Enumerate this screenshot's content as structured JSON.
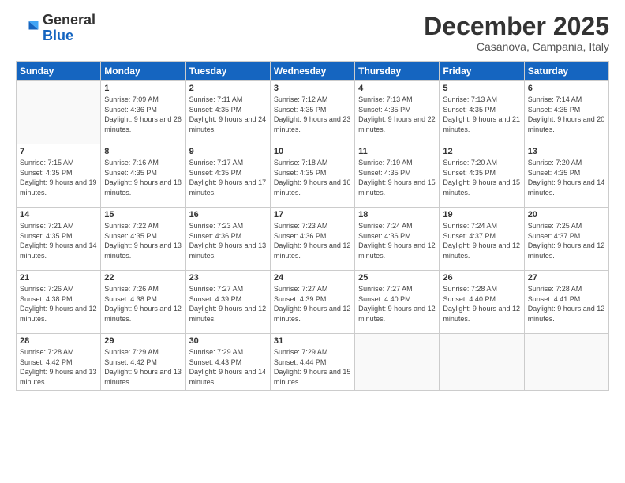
{
  "logo": {
    "general": "General",
    "blue": "Blue"
  },
  "header": {
    "month": "December 2025",
    "location": "Casanova, Campania, Italy"
  },
  "days": [
    "Sunday",
    "Monday",
    "Tuesday",
    "Wednesday",
    "Thursday",
    "Friday",
    "Saturday"
  ],
  "weeks": [
    [
      {
        "num": "",
        "empty": true
      },
      {
        "num": "1",
        "sunrise": "7:09 AM",
        "sunset": "4:36 PM",
        "daylight": "9 hours and 26 minutes."
      },
      {
        "num": "2",
        "sunrise": "7:11 AM",
        "sunset": "4:35 PM",
        "daylight": "9 hours and 24 minutes."
      },
      {
        "num": "3",
        "sunrise": "7:12 AM",
        "sunset": "4:35 PM",
        "daylight": "9 hours and 23 minutes."
      },
      {
        "num": "4",
        "sunrise": "7:13 AM",
        "sunset": "4:35 PM",
        "daylight": "9 hours and 22 minutes."
      },
      {
        "num": "5",
        "sunrise": "7:13 AM",
        "sunset": "4:35 PM",
        "daylight": "9 hours and 21 minutes."
      },
      {
        "num": "6",
        "sunrise": "7:14 AM",
        "sunset": "4:35 PM",
        "daylight": "9 hours and 20 minutes."
      }
    ],
    [
      {
        "num": "7",
        "sunrise": "7:15 AM",
        "sunset": "4:35 PM",
        "daylight": "9 hours and 19 minutes."
      },
      {
        "num": "8",
        "sunrise": "7:16 AM",
        "sunset": "4:35 PM",
        "daylight": "9 hours and 18 minutes."
      },
      {
        "num": "9",
        "sunrise": "7:17 AM",
        "sunset": "4:35 PM",
        "daylight": "9 hours and 17 minutes."
      },
      {
        "num": "10",
        "sunrise": "7:18 AM",
        "sunset": "4:35 PM",
        "daylight": "9 hours and 16 minutes."
      },
      {
        "num": "11",
        "sunrise": "7:19 AM",
        "sunset": "4:35 PM",
        "daylight": "9 hours and 15 minutes."
      },
      {
        "num": "12",
        "sunrise": "7:20 AM",
        "sunset": "4:35 PM",
        "daylight": "9 hours and 15 minutes."
      },
      {
        "num": "13",
        "sunrise": "7:20 AM",
        "sunset": "4:35 PM",
        "daylight": "9 hours and 14 minutes."
      }
    ],
    [
      {
        "num": "14",
        "sunrise": "7:21 AM",
        "sunset": "4:35 PM",
        "daylight": "9 hours and 14 minutes."
      },
      {
        "num": "15",
        "sunrise": "7:22 AM",
        "sunset": "4:35 PM",
        "daylight": "9 hours and 13 minutes."
      },
      {
        "num": "16",
        "sunrise": "7:23 AM",
        "sunset": "4:36 PM",
        "daylight": "9 hours and 13 minutes."
      },
      {
        "num": "17",
        "sunrise": "7:23 AM",
        "sunset": "4:36 PM",
        "daylight": "9 hours and 12 minutes."
      },
      {
        "num": "18",
        "sunrise": "7:24 AM",
        "sunset": "4:36 PM",
        "daylight": "9 hours and 12 minutes."
      },
      {
        "num": "19",
        "sunrise": "7:24 AM",
        "sunset": "4:37 PM",
        "daylight": "9 hours and 12 minutes."
      },
      {
        "num": "20",
        "sunrise": "7:25 AM",
        "sunset": "4:37 PM",
        "daylight": "9 hours and 12 minutes."
      }
    ],
    [
      {
        "num": "21",
        "sunrise": "7:26 AM",
        "sunset": "4:38 PM",
        "daylight": "9 hours and 12 minutes."
      },
      {
        "num": "22",
        "sunrise": "7:26 AM",
        "sunset": "4:38 PM",
        "daylight": "9 hours and 12 minutes."
      },
      {
        "num": "23",
        "sunrise": "7:27 AM",
        "sunset": "4:39 PM",
        "daylight": "9 hours and 12 minutes."
      },
      {
        "num": "24",
        "sunrise": "7:27 AM",
        "sunset": "4:39 PM",
        "daylight": "9 hours and 12 minutes."
      },
      {
        "num": "25",
        "sunrise": "7:27 AM",
        "sunset": "4:40 PM",
        "daylight": "9 hours and 12 minutes."
      },
      {
        "num": "26",
        "sunrise": "7:28 AM",
        "sunset": "4:40 PM",
        "daylight": "9 hours and 12 minutes."
      },
      {
        "num": "27",
        "sunrise": "7:28 AM",
        "sunset": "4:41 PM",
        "daylight": "9 hours and 12 minutes."
      }
    ],
    [
      {
        "num": "28",
        "sunrise": "7:28 AM",
        "sunset": "4:42 PM",
        "daylight": "9 hours and 13 minutes."
      },
      {
        "num": "29",
        "sunrise": "7:29 AM",
        "sunset": "4:42 PM",
        "daylight": "9 hours and 13 minutes."
      },
      {
        "num": "30",
        "sunrise": "7:29 AM",
        "sunset": "4:43 PM",
        "daylight": "9 hours and 14 minutes."
      },
      {
        "num": "31",
        "sunrise": "7:29 AM",
        "sunset": "4:44 PM",
        "daylight": "9 hours and 15 minutes."
      },
      {
        "num": "",
        "empty": true
      },
      {
        "num": "",
        "empty": true
      },
      {
        "num": "",
        "empty": true
      }
    ]
  ]
}
